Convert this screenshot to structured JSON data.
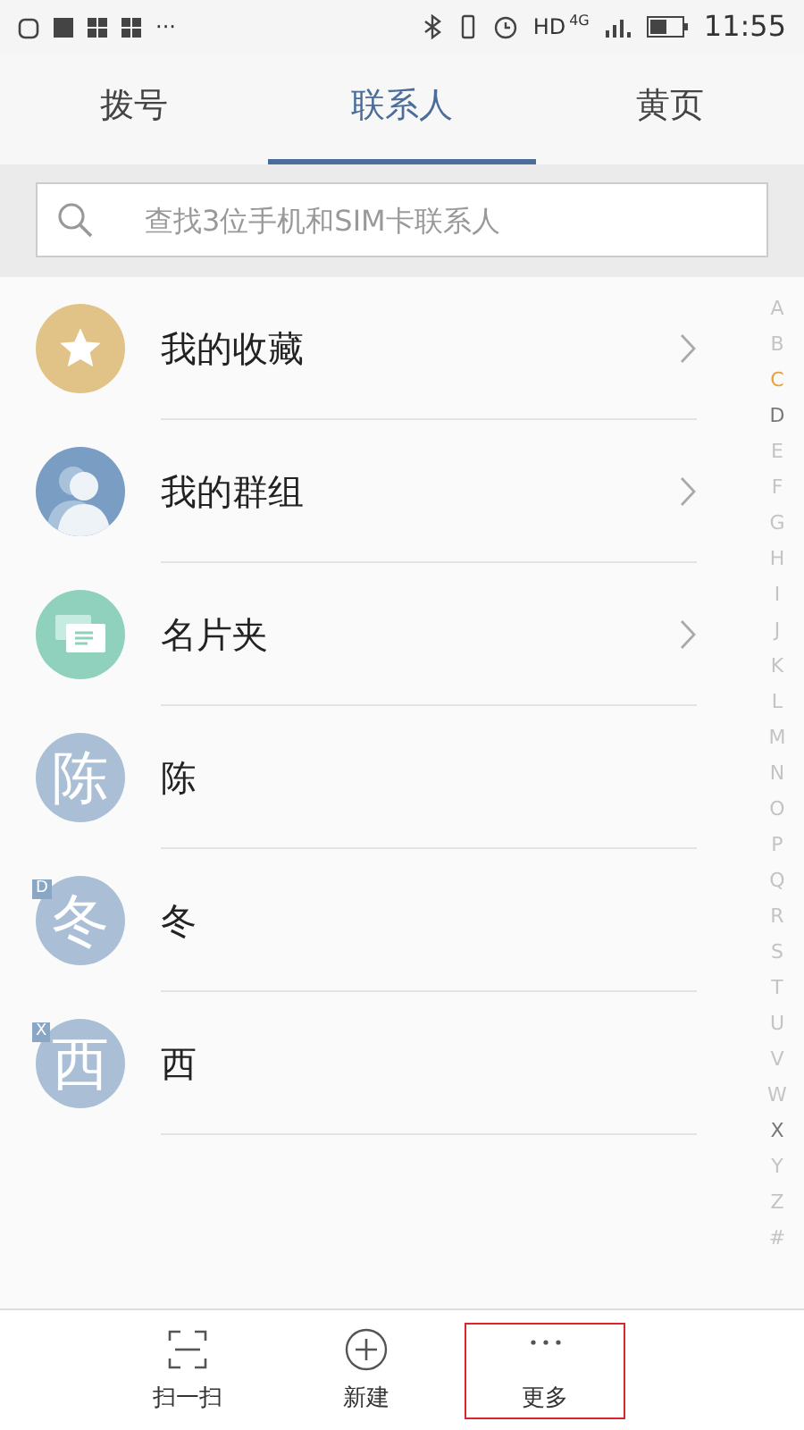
{
  "status_bar": {
    "overflow": "···",
    "network": "HD",
    "network_gen": "4G",
    "time": "11:55"
  },
  "tabs": [
    {
      "label": "拨号",
      "selected": false
    },
    {
      "label": "联系人",
      "selected": true
    },
    {
      "label": "黄页",
      "selected": false
    }
  ],
  "search": {
    "placeholder": "查找3位手机和SIM卡联系人"
  },
  "entries": [
    {
      "kind": "star",
      "label": "我的收藏",
      "color": "#e2c387",
      "chevron": true
    },
    {
      "kind": "group",
      "label": "我的群组",
      "color": "#7a9dc4",
      "chevron": true
    },
    {
      "kind": "cards",
      "label": "名片夹",
      "color": "#8fd1bd",
      "chevron": true
    },
    {
      "kind": "letter",
      "avatar_text": "陈",
      "label": "陈",
      "color": "#aabfd6",
      "chevron": false
    },
    {
      "kind": "letter",
      "avatar_text": "冬",
      "section_mark": "D",
      "label": "冬",
      "color": "#aabfd6",
      "chevron": false
    },
    {
      "kind": "letter",
      "avatar_text": "西",
      "section_mark": "X",
      "label": "西",
      "color": "#aabfd6",
      "chevron": false
    }
  ],
  "index": [
    {
      "letter": "A",
      "selected": false,
      "has_contacts": false
    },
    {
      "letter": "B",
      "selected": false,
      "has_contacts": false
    },
    {
      "letter": "C",
      "selected": true,
      "has_contacts": true
    },
    {
      "letter": "D",
      "selected": false,
      "has_contacts": true
    },
    {
      "letter": "E",
      "selected": false,
      "has_contacts": false
    },
    {
      "letter": "F",
      "selected": false,
      "has_contacts": false
    },
    {
      "letter": "G",
      "selected": false,
      "has_contacts": false
    },
    {
      "letter": "H",
      "selected": false,
      "has_contacts": false
    },
    {
      "letter": "I",
      "selected": false,
      "has_contacts": false
    },
    {
      "letter": "J",
      "selected": false,
      "has_contacts": false
    },
    {
      "letter": "K",
      "selected": false,
      "has_contacts": false
    },
    {
      "letter": "L",
      "selected": false,
      "has_contacts": false
    },
    {
      "letter": "M",
      "selected": false,
      "has_contacts": false
    },
    {
      "letter": "N",
      "selected": false,
      "has_contacts": false
    },
    {
      "letter": "O",
      "selected": false,
      "has_contacts": false
    },
    {
      "letter": "P",
      "selected": false,
      "has_contacts": false
    },
    {
      "letter": "Q",
      "selected": false,
      "has_contacts": false
    },
    {
      "letter": "R",
      "selected": false,
      "has_contacts": false
    },
    {
      "letter": "S",
      "selected": false,
      "has_contacts": false
    },
    {
      "letter": "T",
      "selected": false,
      "has_contacts": false
    },
    {
      "letter": "U",
      "selected": false,
      "has_contacts": false
    },
    {
      "letter": "V",
      "selected": false,
      "has_contacts": false
    },
    {
      "letter": "W",
      "selected": false,
      "has_contacts": false
    },
    {
      "letter": "X",
      "selected": false,
      "has_contacts": true
    },
    {
      "letter": "Y",
      "selected": false,
      "has_contacts": false
    },
    {
      "letter": "Z",
      "selected": false,
      "has_contacts": false
    },
    {
      "letter": "#",
      "selected": false,
      "has_contacts": false
    }
  ],
  "bottom_bar": [
    {
      "kind": "scan",
      "label": "扫一扫",
      "highlighted": false
    },
    {
      "kind": "add",
      "label": "新建",
      "highlighted": false
    },
    {
      "kind": "more",
      "label": "更多",
      "highlighted": true
    }
  ]
}
